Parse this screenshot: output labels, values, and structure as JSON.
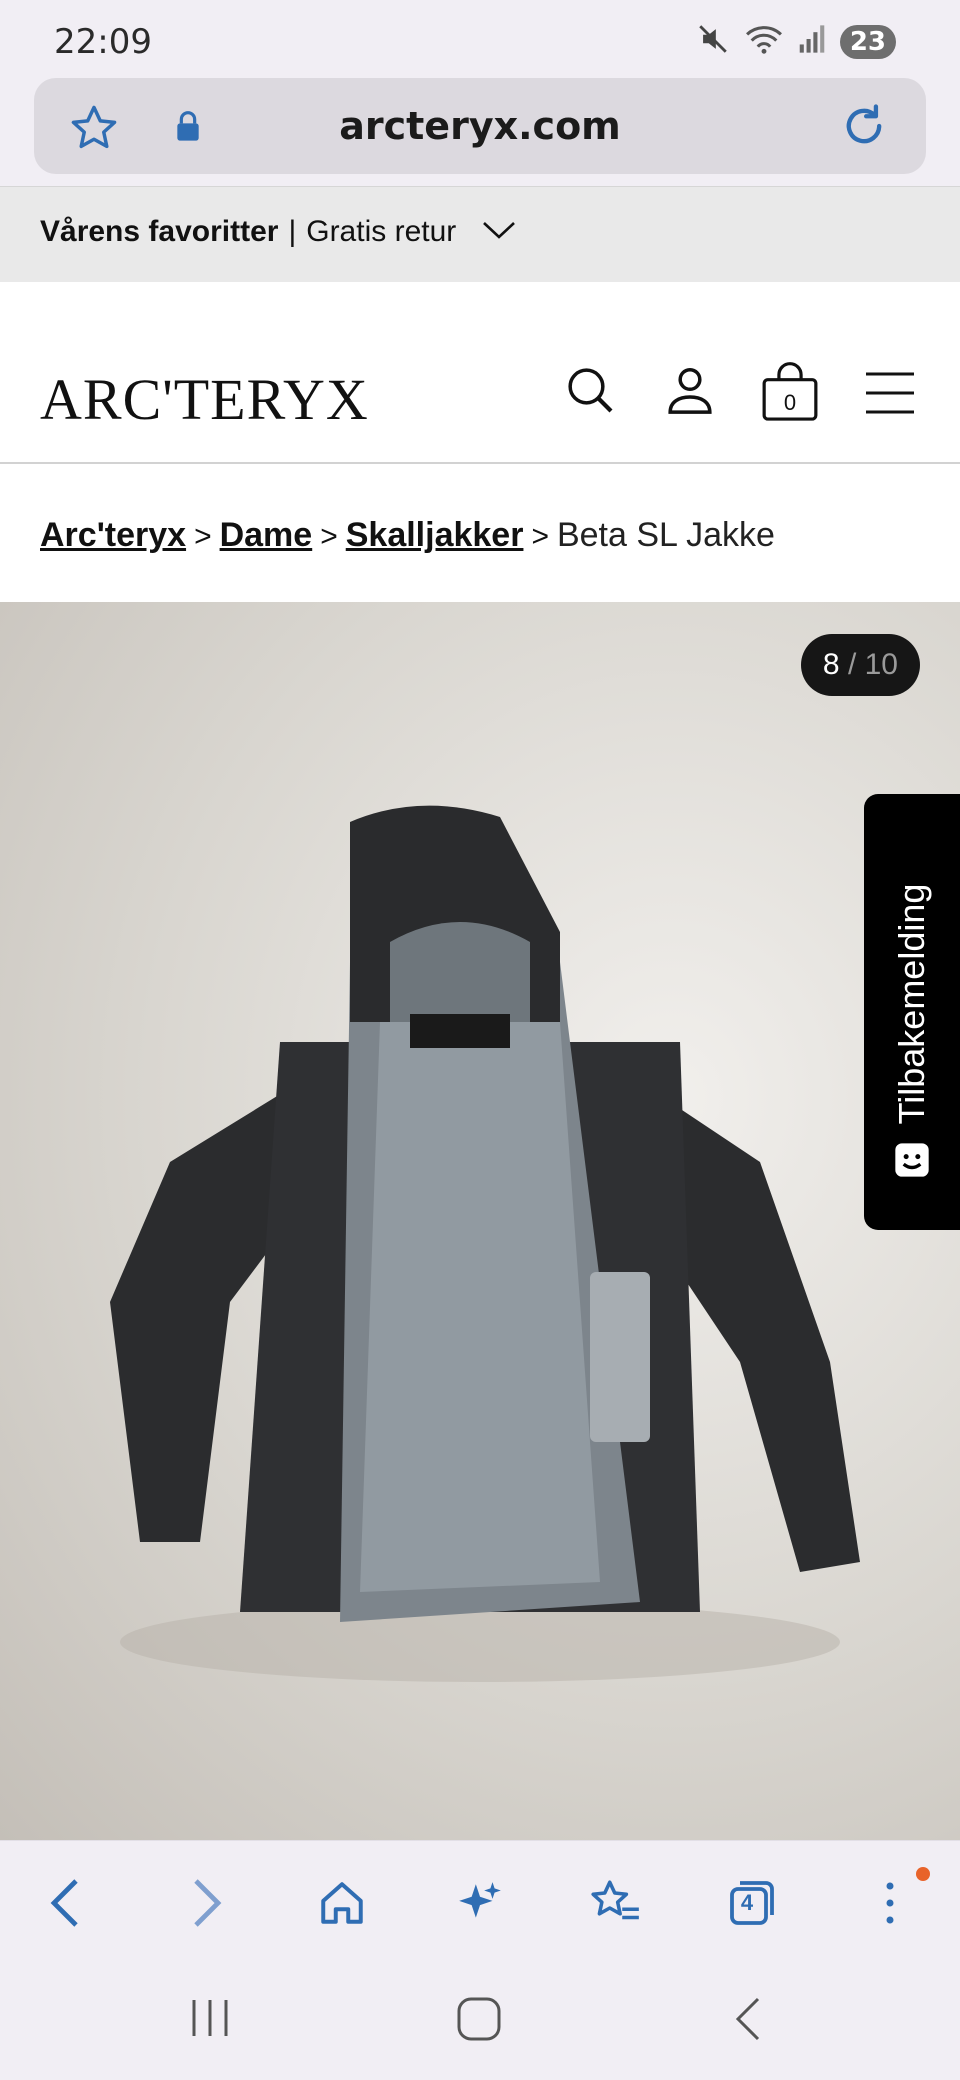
{
  "status_bar": {
    "time": "22:09",
    "battery": "23"
  },
  "browser": {
    "url": "arcteryx.com"
  },
  "promo": {
    "bold": "Vårens favoritter",
    "separator": "|",
    "text": "Gratis retur"
  },
  "header": {
    "logo": "ARC'TERYX",
    "cart_count": "0"
  },
  "breadcrumb": {
    "items": [
      "Arc'teryx",
      "Dame",
      "Skalljakker"
    ],
    "separator": ">",
    "current": "Beta SL Jakke"
  },
  "gallery": {
    "current": "8",
    "separator": "/",
    "total": "10"
  },
  "feedback": {
    "label": "Tilbakemelding"
  },
  "bottom_nav": {
    "tabs_count": "4"
  },
  "colors": {
    "accent_blue": "#2f6db3",
    "notification": "#e8632a"
  }
}
